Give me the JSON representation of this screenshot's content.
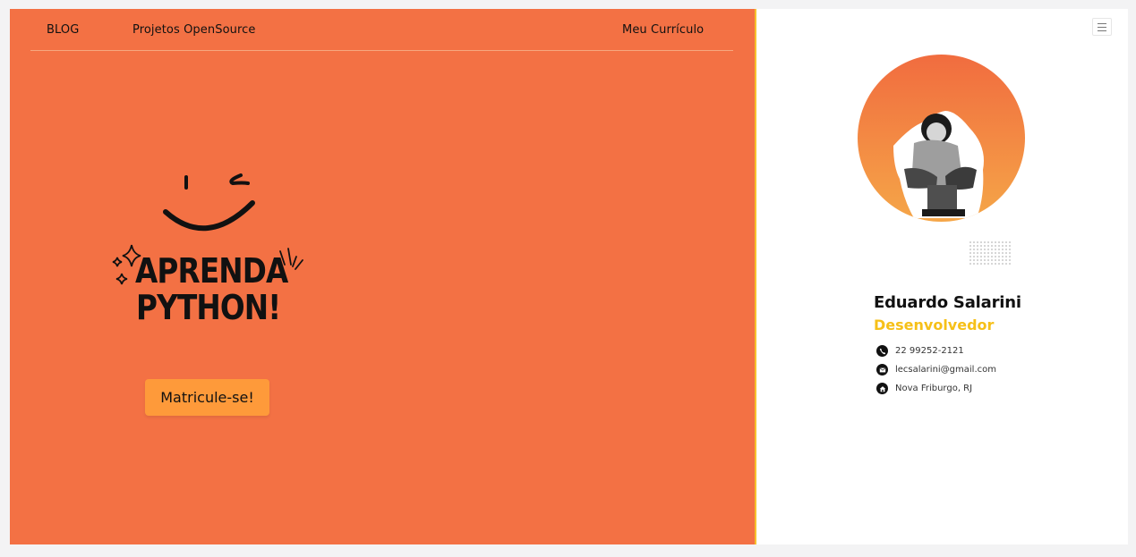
{
  "nav": {
    "blog": "BLOG",
    "projects": "Projetos OpenSource",
    "cv": "Meu Currículo"
  },
  "hero": {
    "line1": "APRENDA",
    "line2": "PYTHON!",
    "cta": "Matricule-se!"
  },
  "profile": {
    "name": "Eduardo Salarini",
    "role": "Desenvolvedor",
    "phone": "22 99252-2121",
    "email": "lecsalarini@gmail.com",
    "location": "Nova Friburgo, RJ"
  },
  "colors": {
    "panel": "#f37144",
    "accent": "#f6c12d",
    "button": "#fe9a3a",
    "role": "#f6c018"
  },
  "icons": [
    "menu-icon",
    "phone-icon",
    "email-icon",
    "home-icon",
    "smile-wink-icon",
    "sparkle-icon"
  ]
}
